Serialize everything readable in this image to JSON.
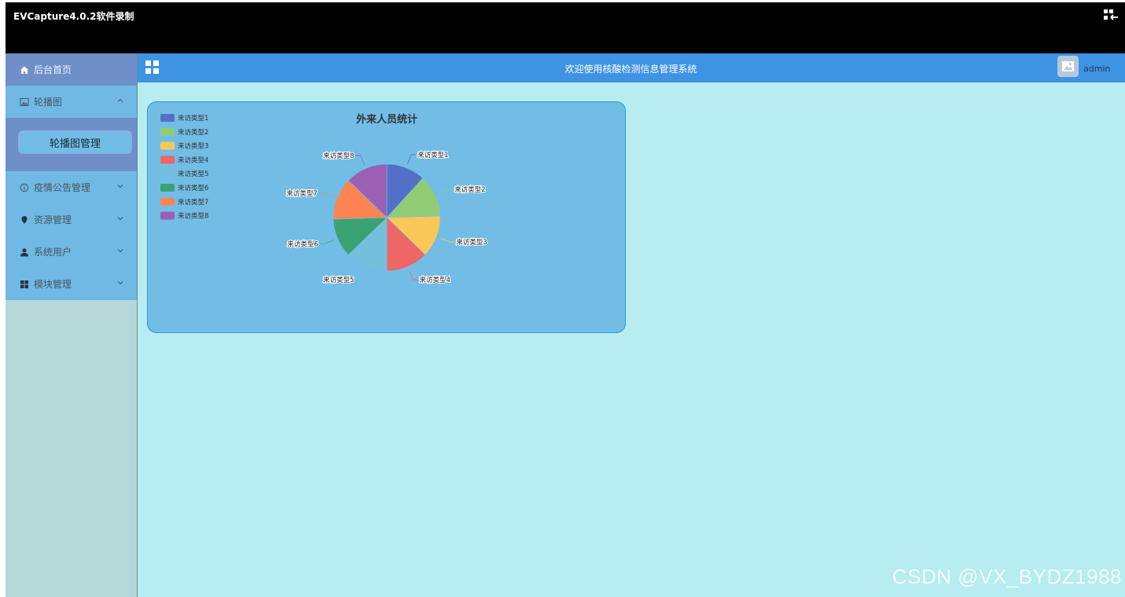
{
  "window": {
    "title": "EVCapture4.0.2软件录制"
  },
  "header": {
    "system_title": "欢迎使用核酸检测信息管理系统",
    "user_name": "admin"
  },
  "sidebar": {
    "items": [
      {
        "label": "后台首页",
        "icon": "home-icon"
      },
      {
        "label": "轮播图",
        "icon": "image-icon",
        "expanded": true
      },
      {
        "label": "疫情公告管理",
        "icon": "info-circle-icon"
      },
      {
        "label": "资源管理",
        "icon": "location-pin-icon"
      },
      {
        "label": "系统用户",
        "icon": "user-icon"
      },
      {
        "label": "模块管理",
        "icon": "grid-icon"
      }
    ],
    "submenu": {
      "label": "轮播图管理"
    }
  },
  "chart_data": {
    "type": "pie",
    "title": "外来人员统计",
    "legend_position": "top-left",
    "categories": [
      "来访类型1",
      "来访类型2",
      "来访类型3",
      "来访类型4",
      "来访类型5",
      "来访类型6",
      "来访类型7",
      "来访类型8"
    ],
    "values": [
      12,
      13,
      13,
      13,
      13,
      12,
      13,
      13
    ],
    "colors": [
      "#5470c6",
      "#91cc75",
      "#fac858",
      "#ee6666",
      "#73c0de",
      "#3ba272",
      "#fc8452",
      "#9a60b4"
    ]
  },
  "watermark": "CSDN @VX_BYDZ1988"
}
